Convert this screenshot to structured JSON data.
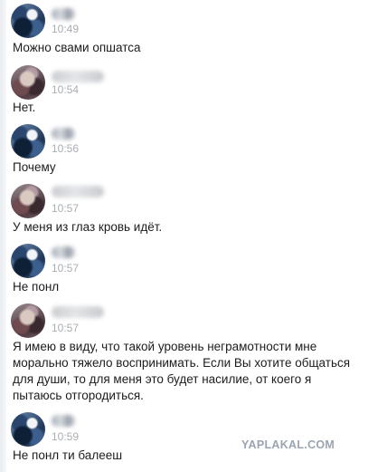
{
  "messages": [
    {
      "sender": "me",
      "time": "10:49",
      "text": "Можно свами опшатса"
    },
    {
      "sender": "other",
      "time": "10:54",
      "text": "Нет."
    },
    {
      "sender": "me",
      "time": "10:56",
      "text": "Почему"
    },
    {
      "sender": "other",
      "time": "10:57",
      "text": "У меня из глаз кровь идёт."
    },
    {
      "sender": "me",
      "time": "10:57",
      "text": "Не понл"
    },
    {
      "sender": "other",
      "time": "10:57",
      "text": "Я имею в виду, что такой уровень неграмотности мне\nморально тяжело воспринимать. Если Вы хотите общаться\nдля души, то для меня это будет насилие, от коего я\nпытаюсь отгородиться."
    },
    {
      "sender": "me",
      "time": "10:59",
      "text": "Не понл ти балееш"
    }
  ],
  "watermark": "YAPLAKAL.COM"
}
